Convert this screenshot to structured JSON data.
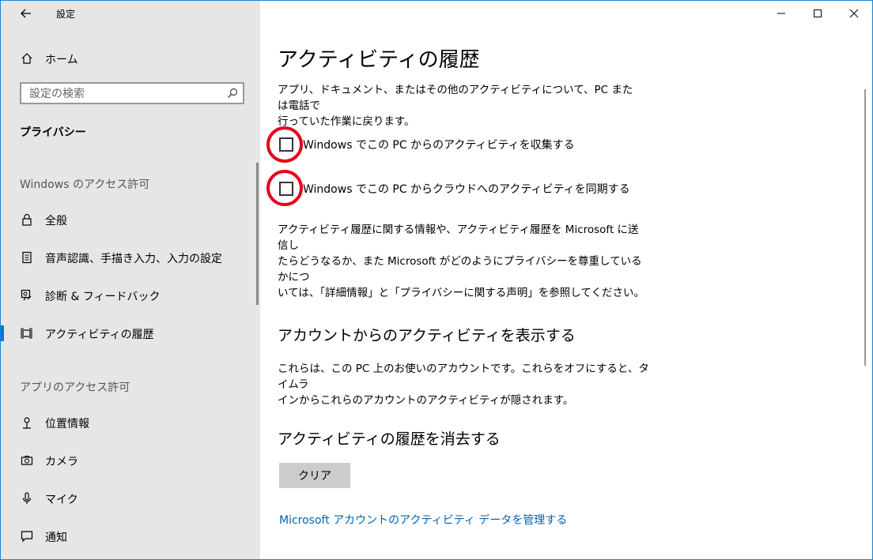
{
  "window": {
    "app_title": "設定",
    "accent_color": "#0078d7",
    "controls": [
      "minimize-icon",
      "maximize-icon",
      "close-icon"
    ]
  },
  "sidebar": {
    "home_label": "ホーム",
    "search_placeholder": "設定の検索",
    "category": "プライバシー",
    "groups": [
      {
        "header": "Windows のアクセス許可",
        "items": [
          {
            "label": "全般",
            "icon": "lock-icon"
          },
          {
            "label": "音声認識、手描き入力、入力の設定",
            "icon": "document-icon"
          },
          {
            "label": "診断 & フィードバック",
            "icon": "feedback-icon"
          },
          {
            "label": "アクティビティの履歴",
            "icon": "timeline-icon",
            "selected": true
          }
        ]
      },
      {
        "header": "アプリのアクセス許可",
        "items": [
          {
            "label": "位置情報",
            "icon": "location-icon"
          },
          {
            "label": "カメラ",
            "icon": "camera-icon"
          },
          {
            "label": "マイク",
            "icon": "microphone-icon"
          },
          {
            "label": "通知",
            "icon": "notification-icon"
          }
        ]
      }
    ]
  },
  "content": {
    "title": "アクティビティの履歴",
    "intro_line1": "アプリ、ドキュメント、またはその他のアクティビティについて、PC または電話で",
    "intro_line2": "行っていた作業に戻ります。",
    "checkboxes": [
      {
        "label": "Windows でこの PC からのアクティビティを収集する",
        "checked": false
      },
      {
        "label": "Windows でこの PC からクラウドへのアクティビティを同期する",
        "checked": false
      }
    ],
    "info_line1": "アクティビティ履歴に関する情報や、アクティビティ履歴を Microsoft に送信し",
    "info_line2": "たらどうなるか、また Microsoft がどのようにプライバシーを尊重しているかにつ",
    "info_line3": "いては、「詳細情報」と「プライバシーに関する声明」を参照してください。",
    "accounts_title": "アカウントからのアクティビティを表示する",
    "accounts_line1": "これらは、この PC 上のお使いのアカウントです。これらをオフにすると、タイムラ",
    "accounts_line2": "インからこれらのアカウントのアクティビティが隠されます。",
    "clear_title": "アクティビティの履歴を消去する",
    "clear_button": "クリア",
    "manage_link": "Microsoft アカウントのアクティビティ データを管理する",
    "highlight_color": "#e8001c"
  }
}
